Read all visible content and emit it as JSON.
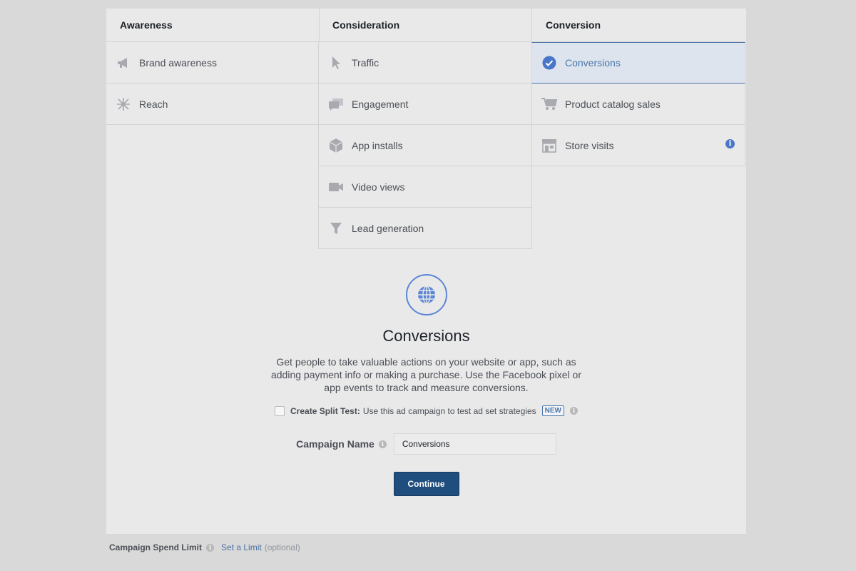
{
  "columns": [
    {
      "header": "Awareness",
      "items": [
        {
          "label": "Brand awareness",
          "icon": "megaphone-icon"
        },
        {
          "label": "Reach",
          "icon": "reach-icon"
        }
      ]
    },
    {
      "header": "Consideration",
      "items": [
        {
          "label": "Traffic",
          "icon": "cursor-icon"
        },
        {
          "label": "Engagement",
          "icon": "chat-bubbles-icon"
        },
        {
          "label": "App installs",
          "icon": "box-icon"
        },
        {
          "label": "Video views",
          "icon": "video-camera-icon"
        },
        {
          "label": "Lead generation",
          "icon": "funnel-icon"
        }
      ]
    },
    {
      "header": "Conversion",
      "items": [
        {
          "label": "Conversions",
          "icon": "check-circle-icon",
          "selected": true
        },
        {
          "label": "Product catalog sales",
          "icon": "cart-icon"
        },
        {
          "label": "Store visits",
          "icon": "store-icon",
          "info": "i"
        }
      ]
    }
  ],
  "detail": {
    "icon": "globe-icon",
    "title": "Conversions",
    "description": "Get people to take valuable actions on your website or app, such as adding payment info or making a purchase. Use the Facebook pixel or app events to track and measure conversions."
  },
  "split_test": {
    "label": "Create Split Test:",
    "text": "Use this ad campaign to test ad set strategies",
    "badge": "NEW",
    "info": "i"
  },
  "campaign_name": {
    "label": "Campaign Name",
    "info": "i",
    "value": "Conversions"
  },
  "continue_label": "Continue",
  "footer": {
    "label": "Campaign Spend Limit",
    "info": "i",
    "link": "Set a Limit",
    "optional": "(optional)"
  },
  "colors": {
    "accent": "#4a76a8",
    "button": "#1f4d7d",
    "selected_bg": "#dde4ee"
  }
}
